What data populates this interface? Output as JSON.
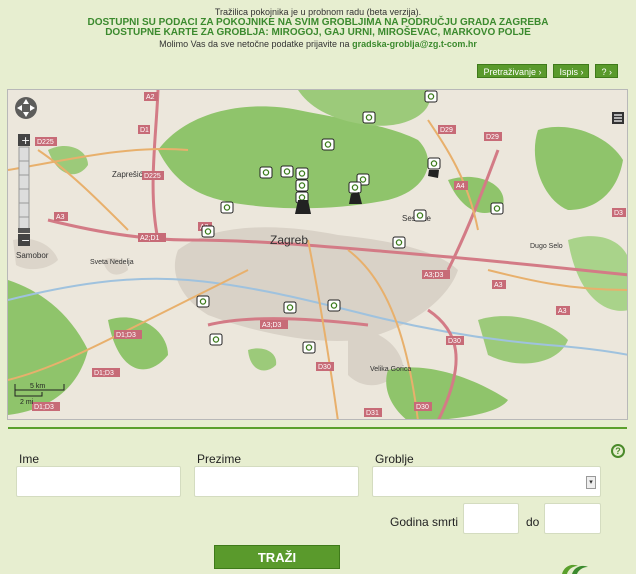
{
  "intro": {
    "line1": "Tražilica pokojnika je u probnom radu (beta verzija).",
    "line2": "DOSTUPNI SU PODACI ZA POKOJNIKE NA SVIM GROBLJIMA NA PODRUČJU GRADA ZAGREBA",
    "line3": "DOSTUPNE KARTE ZA GROBLJA: MIROGOJ, GAJ URNI, MIROŠEVAC, MARKOVO POLJE",
    "line4_prefix": "Molimo Vas da sve netočne podatke prijavite na",
    "email": "gradska-groblja@zg.t-com.hr"
  },
  "toolbar": {
    "search_label": "Pretraživanje",
    "print_label": "Ispis",
    "help_label": "?"
  },
  "map": {
    "city_labels": {
      "zagreb": "Zagreb",
      "zapresic": "Zaprešić",
      "samobor": "Samobor",
      "sveta_nedelja": "Sveta Nedelja",
      "sesvete": "Sesvete",
      "dugo_selo": "Dugo Selo",
      "velika_gorica": "Velika Gorica"
    },
    "road_labels": [
      "D1",
      "A2",
      "D225",
      "D225",
      "A3",
      "A2;D1",
      "A2",
      "D29",
      "D29",
      "A4",
      "A3;D3",
      "A3",
      "A3;D3",
      "D1;D3",
      "D1;D3",
      "D1;D3",
      "D30",
      "D30",
      "D31",
      "D30",
      "D3",
      "A3"
    ],
    "scale": {
      "km": "5 km",
      "mi": "2 mi"
    },
    "zoom": {
      "plus": "+",
      "minus": "−"
    }
  },
  "form": {
    "ime_label": "Ime",
    "prezime_label": "Prezime",
    "groblje_label": "Groblje",
    "godina_label": "Godina smrti",
    "do_label": "do",
    "ime_value": "",
    "prezime_value": "",
    "groblje_value": "",
    "od_value": "",
    "do_value": "",
    "submit_label": "TRAŽI",
    "help_label": "?"
  },
  "colors": {
    "page_bg": "#e7eed0",
    "accent": "#5a9a2c",
    "title_green": "#3b8a2e",
    "map_bg": "#ece7dc",
    "forest": "#8fc46b",
    "urban": "#d9d2c7",
    "motorway": "#d37b86",
    "primary_road": "#e8b06c"
  }
}
